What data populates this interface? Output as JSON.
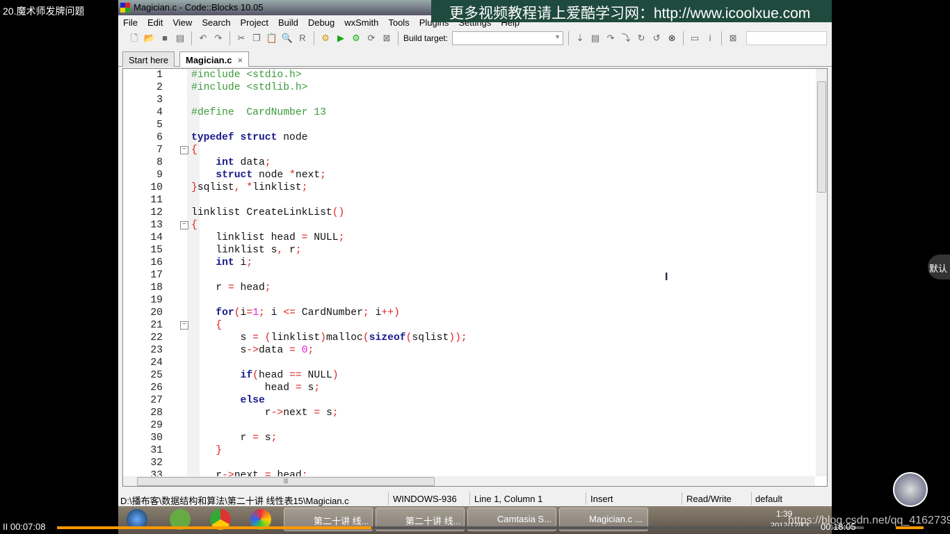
{
  "video": {
    "title": "20.魔术师发牌问题",
    "elapsed": "00:07:08",
    "duration": "00:18:05",
    "progress": 0.39,
    "watermark_url": "https://blog.csdn.net/qq_41627390",
    "side_label": "默认",
    "play_icon": "pause-icon"
  },
  "window": {
    "title": "Magician.c - Code::Blocks 10.05",
    "banner": "更多视频教程请上爱酷学习网：http://www.icoolxue.com"
  },
  "menu": [
    "File",
    "Edit",
    "View",
    "Search",
    "Project",
    "Build",
    "Debug",
    "wxSmith",
    "Tools",
    "Plugins",
    "Settings",
    "Help"
  ],
  "toolbar": {
    "build_target_label": "Build target:",
    "build_target_value": ""
  },
  "tabs": [
    {
      "label": "Start here"
    },
    {
      "label": "Magician.c",
      "close": "×"
    }
  ],
  "code": [
    [
      [
        "p",
        "#include <stdio.h>"
      ]
    ],
    [
      [
        "p",
        "#include <stdlib.h>"
      ]
    ],
    [],
    [
      [
        "p",
        "#define  CardNumber 13"
      ]
    ],
    [],
    [
      [
        "k",
        "typedef"
      ],
      [
        "t",
        " "
      ],
      [
        "k",
        "struct"
      ],
      [
        "t",
        " node"
      ]
    ],
    [
      [
        "o",
        "{"
      ]
    ],
    [
      [
        "t",
        "    "
      ],
      [
        "k",
        "int"
      ],
      [
        "t",
        " data"
      ],
      [
        "o",
        ";"
      ]
    ],
    [
      [
        "t",
        "    "
      ],
      [
        "k",
        "struct"
      ],
      [
        "t",
        " node "
      ],
      [
        "o",
        "*"
      ],
      [
        "t",
        "next"
      ],
      [
        "o",
        ";"
      ]
    ],
    [
      [
        "o",
        "}"
      ],
      [
        "t",
        "sqlist"
      ],
      [
        "o",
        ", *"
      ],
      [
        "t",
        "linklist"
      ],
      [
        "o",
        ";"
      ]
    ],
    [],
    [
      [
        "t",
        "linklist CreateLinkList"
      ],
      [
        "o",
        "()"
      ]
    ],
    [
      [
        "o",
        "{"
      ]
    ],
    [
      [
        "t",
        "    linklist head "
      ],
      [
        "o",
        "="
      ],
      [
        "t",
        " NULL"
      ],
      [
        "o",
        ";"
      ]
    ],
    [
      [
        "t",
        "    linklist s"
      ],
      [
        "o",
        ","
      ],
      [
        "t",
        " r"
      ],
      [
        "o",
        ";"
      ]
    ],
    [
      [
        "t",
        "    "
      ],
      [
        "k",
        "int"
      ],
      [
        "t",
        " i"
      ],
      [
        "o",
        ";"
      ]
    ],
    [],
    [
      [
        "t",
        "    r "
      ],
      [
        "o",
        "="
      ],
      [
        "t",
        " head"
      ],
      [
        "o",
        ";"
      ]
    ],
    [],
    [
      [
        "t",
        "    "
      ],
      [
        "k",
        "for"
      ],
      [
        "o",
        "("
      ],
      [
        "t",
        "i"
      ],
      [
        "o",
        "="
      ],
      [
        "n",
        "1"
      ],
      [
        "o",
        ";"
      ],
      [
        "t",
        " i "
      ],
      [
        "o",
        "<="
      ],
      [
        "t",
        " CardNumber"
      ],
      [
        "o",
        ";"
      ],
      [
        "t",
        " i"
      ],
      [
        "o",
        "++)"
      ]
    ],
    [
      [
        "t",
        "    "
      ],
      [
        "o",
        "{"
      ]
    ],
    [
      [
        "t",
        "        s "
      ],
      [
        "o",
        "="
      ],
      [
        "t",
        " "
      ],
      [
        "o",
        "("
      ],
      [
        "t",
        "linklist"
      ],
      [
        "o",
        ")"
      ],
      [
        "t",
        "malloc"
      ],
      [
        "o",
        "("
      ],
      [
        "k",
        "sizeof"
      ],
      [
        "o",
        "("
      ],
      [
        "t",
        "sqlist"
      ],
      [
        "o",
        "));"
      ]
    ],
    [
      [
        "t",
        "        s"
      ],
      [
        "o",
        "->"
      ],
      [
        "t",
        "data "
      ],
      [
        "o",
        "="
      ],
      [
        "t",
        " "
      ],
      [
        "n",
        "0"
      ],
      [
        "o",
        ";"
      ]
    ],
    [],
    [
      [
        "t",
        "        "
      ],
      [
        "k",
        "if"
      ],
      [
        "o",
        "("
      ],
      [
        "t",
        "head "
      ],
      [
        "o",
        "=="
      ],
      [
        "t",
        " NULL"
      ],
      [
        "o",
        ")"
      ]
    ],
    [
      [
        "t",
        "            head "
      ],
      [
        "o",
        "="
      ],
      [
        "t",
        " s"
      ],
      [
        "o",
        ";"
      ]
    ],
    [
      [
        "t",
        "        "
      ],
      [
        "k",
        "else"
      ]
    ],
    [
      [
        "t",
        "            r"
      ],
      [
        "o",
        "->"
      ],
      [
        "t",
        "next "
      ],
      [
        "o",
        "="
      ],
      [
        "t",
        " s"
      ],
      [
        "o",
        ";"
      ]
    ],
    [],
    [
      [
        "t",
        "        r "
      ],
      [
        "o",
        "="
      ],
      [
        "t",
        " s"
      ],
      [
        "o",
        ";"
      ]
    ],
    [
      [
        "t",
        "    "
      ],
      [
        "o",
        "}"
      ]
    ],
    [],
    [
      [
        "t",
        "    r"
      ],
      [
        "o",
        "->"
      ],
      [
        "t",
        "next "
      ],
      [
        "o",
        "="
      ],
      [
        "t",
        " head"
      ],
      [
        "o",
        ";"
      ]
    ]
  ],
  "fold_lines": [
    7,
    13,
    21
  ],
  "status": {
    "path": "D:\\播布客\\数据结构和算法\\第二十讲 线性表15\\Magician.c",
    "encoding": "WINDOWS-936",
    "position": "Line 1, Column 1",
    "mode": "Insert",
    "access": "Read/Write",
    "lang": "default"
  },
  "taskbar": {
    "items": [
      "第二十讲 线...",
      "第二十讲 线...",
      "Camtasia S...",
      "Magician.c ..."
    ],
    "clock": "1:39",
    "date": "2012/12/13"
  }
}
